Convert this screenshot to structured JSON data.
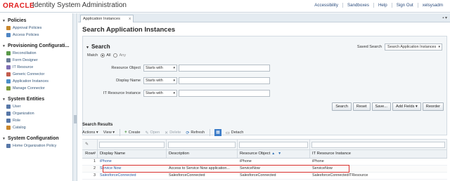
{
  "header": {
    "logo": "ORACLE",
    "title": "Identity System Administration",
    "links": [
      "Accessibility",
      "Sandboxes",
      "Help",
      "Sign Out",
      "xelsysadm"
    ]
  },
  "sidebar": {
    "sections": [
      {
        "title": "Policies",
        "items": [
          {
            "label": "Approval Policies",
            "icon": "approval-policy-icon",
            "color": "#c9862c"
          },
          {
            "label": "Access Policies",
            "icon": "access-policy-icon",
            "color": "#4f86c4"
          }
        ]
      },
      {
        "title": "Provisioning Configurati...",
        "items": [
          {
            "label": "Reconciliation",
            "icon": "reconciliation-icon",
            "color": "#5a9a4a"
          },
          {
            "label": "Form Designer",
            "icon": "form-designer-icon",
            "color": "#6b7d99"
          },
          {
            "label": "IT Resource",
            "icon": "it-resource-icon",
            "color": "#7f6fb4"
          },
          {
            "label": "Generic Connector",
            "icon": "connector-icon",
            "color": "#c35d4d"
          },
          {
            "label": "Application Instances",
            "icon": "app-instance-icon",
            "color": "#4a8fc9"
          },
          {
            "label": "Manage Connector",
            "icon": "manage-connector-icon",
            "color": "#7c9a3c"
          }
        ]
      },
      {
        "title": "System Entities",
        "items": [
          {
            "label": "User",
            "icon": "user-icon",
            "color": "#5878a8"
          },
          {
            "label": "Organization",
            "icon": "organization-icon",
            "color": "#5878a8"
          },
          {
            "label": "Role",
            "icon": "role-icon",
            "color": "#5878a8"
          },
          {
            "label": "Catalog",
            "icon": "catalog-icon",
            "color": "#c9862c"
          }
        ]
      },
      {
        "title": "System Configuration",
        "items": [
          {
            "label": "Home Organization Policy",
            "icon": "home-org-policy-icon",
            "color": "#5878a8"
          }
        ]
      }
    ]
  },
  "tab": {
    "label": "Application Instances",
    "close": "x"
  },
  "page_title": "Search Application Instances",
  "search": {
    "heading": "Search",
    "saved_label": "Saved Search",
    "saved_value": "Search Application Instances",
    "match_label": "Match",
    "match_all": "All",
    "match_any": "Any",
    "fields": [
      {
        "label": "Resource Object",
        "operator": "Starts with",
        "value": ""
      },
      {
        "label": "Display Name",
        "operator": "Starts with",
        "value": ""
      },
      {
        "label": "IT Resource Instance",
        "operator": "Starts with",
        "value": ""
      }
    ],
    "buttons": [
      "Search",
      "Reset",
      "Save...",
      "Add Fields",
      "Reorder"
    ]
  },
  "results": {
    "heading": "Search Results",
    "toolbar": {
      "actions": "Actions",
      "view": "View",
      "create": "Create",
      "open": "Open",
      "delete": "Delete",
      "refresh": "Refresh",
      "detach": "Detach"
    },
    "columns": [
      "Row#",
      "Display Name",
      "Description",
      "Resource Object",
      "IT Resource Instance"
    ],
    "rows": [
      {
        "num": "1",
        "display": "iPhone",
        "desc": "",
        "resource": "iPhone",
        "itres": "iPhone"
      },
      {
        "num": "2",
        "display": "Service Now",
        "desc": "Access to Service Now application...",
        "resource": "ServiceNow",
        "itres": "ServiceNow"
      },
      {
        "num": "3",
        "display": "SalesforceConnected",
        "desc": "SalesforceConnected",
        "resource": "SalesforceConnected",
        "itres": "SalesforceConnectedITResource"
      }
    ]
  },
  "colors": {
    "accent": "#2a5aa0",
    "highlight": "#d9302c",
    "oracle_red": "#e01b1b"
  }
}
